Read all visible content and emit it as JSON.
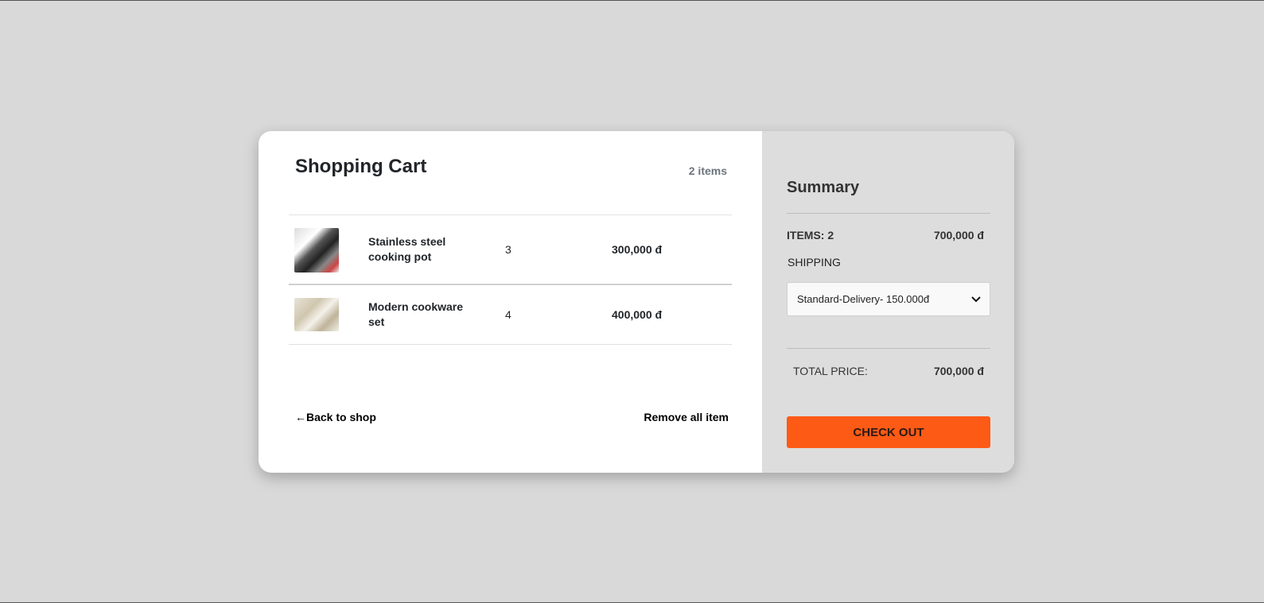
{
  "cart": {
    "title": "Shopping Cart",
    "count": "2 items",
    "items": [
      {
        "name": "Stainless steel cooking pot",
        "qty": "3",
        "price": "300,000 đ",
        "image": "pot-set-image"
      },
      {
        "name": "Modern cookware set",
        "qty": "4",
        "price": "400,000 đ",
        "image": "cookware-set-image"
      }
    ],
    "back_label": "Back to shop",
    "back_arrow": "←",
    "remove_all_label": "Remove all item"
  },
  "summary": {
    "title": "Summary",
    "items_label": "ITEMS: 2",
    "items_value": "700,000 đ",
    "shipping_label": "SHIPPING",
    "shipping_selected": "Standard-Delivery- 150.000đ",
    "total_label": "TOTAL PRICE:",
    "total_value": "700,000 đ",
    "checkout_label": "CHECK OUT"
  },
  "colors": {
    "page_bg": "#d9d9d9",
    "summary_bg": "#dddddd",
    "accent": "#fd5a16"
  }
}
